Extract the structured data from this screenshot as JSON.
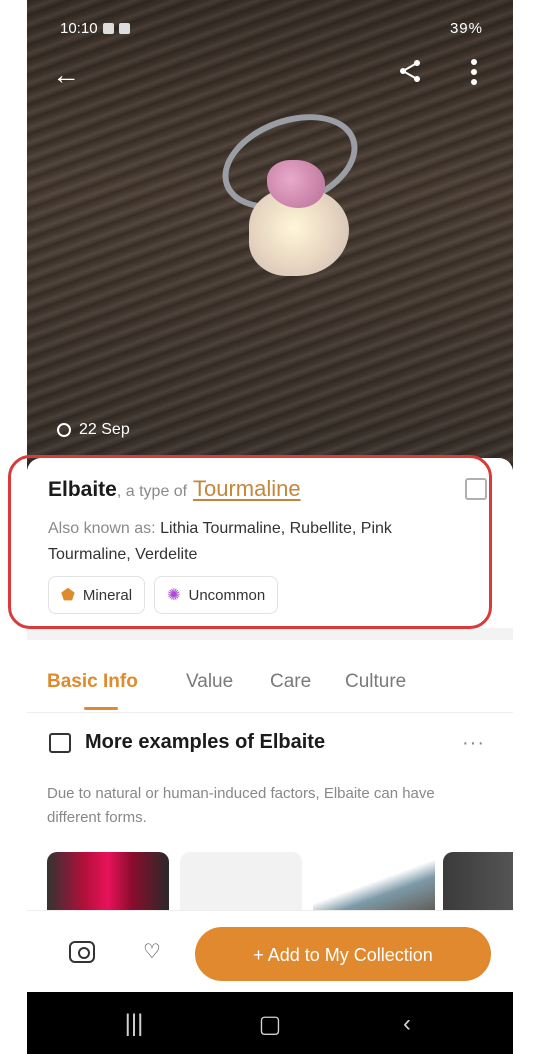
{
  "status": {
    "time": "10:10",
    "battery": "39%"
  },
  "photo": {
    "date": "22 Sep"
  },
  "card": {
    "name": "Elbaite",
    "type_of": ", a type of",
    "parent": "Tourmaline",
    "aka_label": "Also known as:",
    "aka_value": "Lithia Tourmaline, Rubellite, Pink Tourmaline, Verdelite",
    "chips": [
      "Mineral",
      "Uncommon"
    ]
  },
  "tabs": [
    "Basic Info",
    "Value",
    "Care",
    "Culture"
  ],
  "examples": {
    "title": "More examples of Elbaite",
    "desc": "Due to natural or human-induced factors, Elbaite can have different forms."
  },
  "bottom": {
    "add_label": "+ Add to My Collection"
  },
  "icons": {
    "back": "back-arrow-icon",
    "share": "share-icon",
    "more": "more-vertical-icon",
    "mineral": "gem-icon",
    "uncommon": "sparkle-icon",
    "gallery": "gallery-icon",
    "camera": "camera-icon",
    "heart": "heart-add-icon"
  },
  "colors": {
    "accent": "#e08a2e",
    "annotation": "#d93a3a"
  }
}
